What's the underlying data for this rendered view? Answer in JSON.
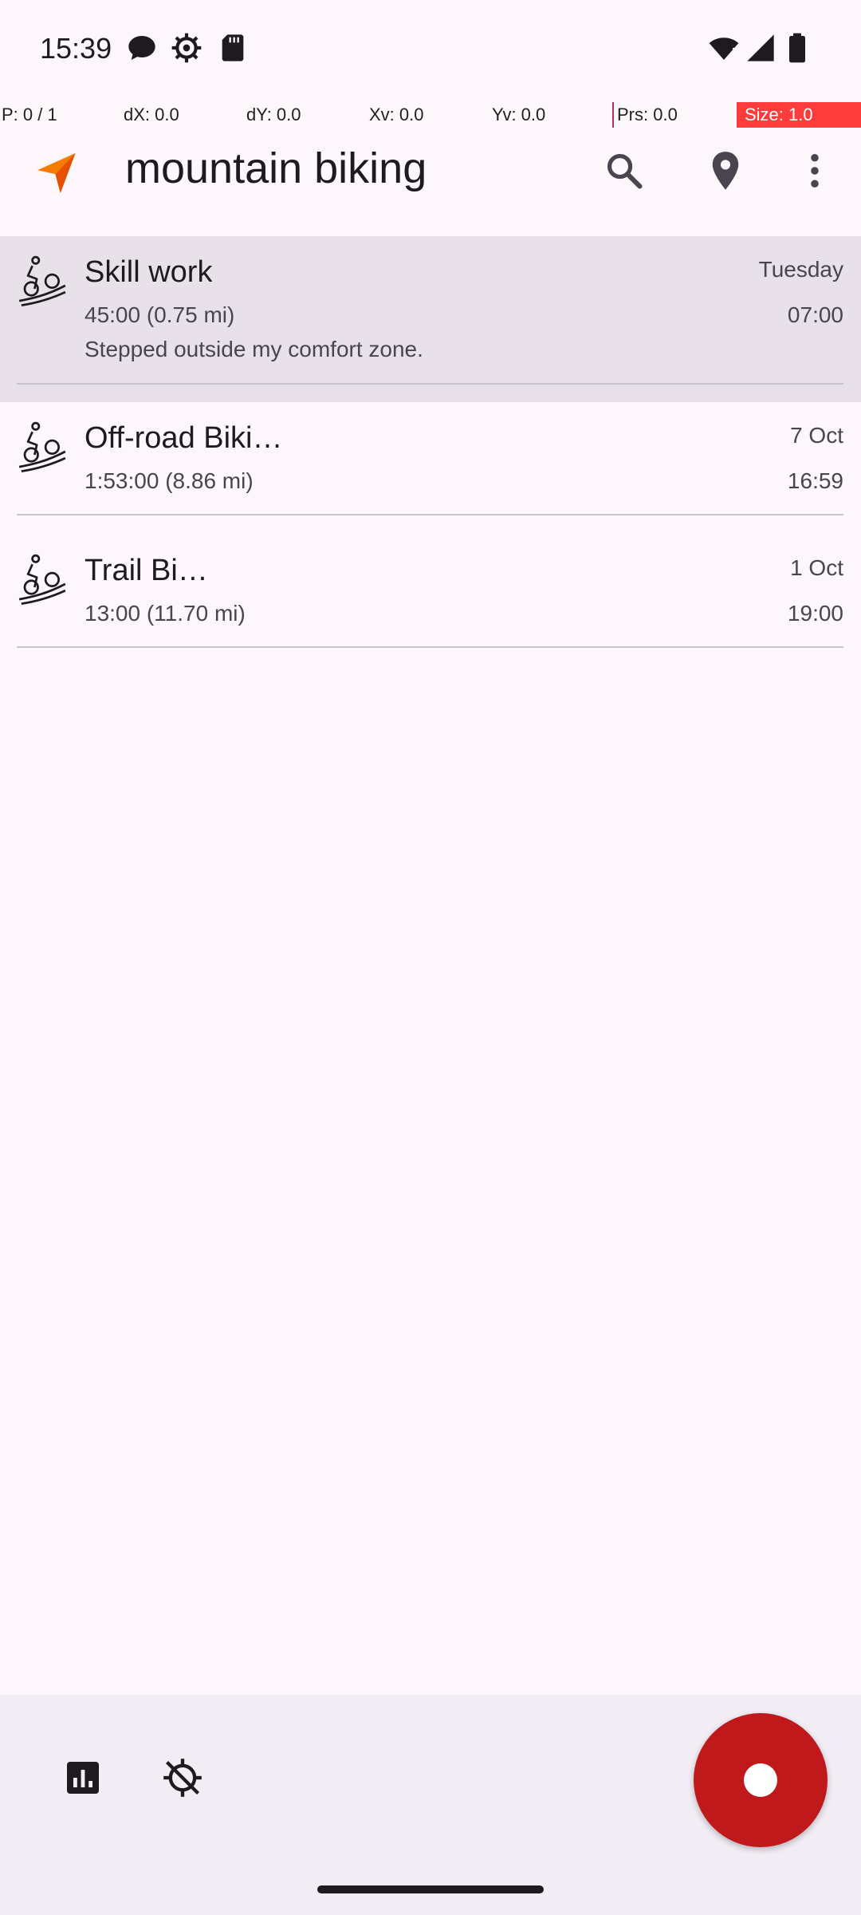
{
  "status_bar": {
    "time": "15:39",
    "left_icons": [
      "chat-bubble-icon",
      "gear-icon",
      "sd-card-icon"
    ],
    "right_icons": [
      "wifi-alert-icon",
      "signal-icon",
      "battery-icon"
    ]
  },
  "debug": {
    "pointer": "P: 0 / 1",
    "dx": "dX: 0.0",
    "dy": "dY: 0.0",
    "xv": "Xv: 0.0",
    "yv": "Yv: 0.0",
    "prs": "Prs: 0.0",
    "size": "Size: 1.0"
  },
  "app_bar": {
    "title": "mountain biking",
    "actions": [
      "search-icon",
      "map-marker-icon",
      "more-vert-icon"
    ]
  },
  "tracks": [
    {
      "title": "Skill work",
      "duration_distance": "45:00 (0.75 mi)",
      "date": "Tuesday",
      "time": "07:00",
      "note": "Stepped outside my comfort zone.",
      "selected": true
    },
    {
      "title": "Off-road Biki…",
      "duration_distance": "1:53:00 (8.86 mi)",
      "date": "7 Oct",
      "time": "16:59",
      "note": "",
      "selected": false
    },
    {
      "title": "Trail Bi…",
      "duration_distance": "13:00 (11.70 mi)",
      "date": "1 Oct",
      "time": "19:00",
      "note": "",
      "selected": false
    }
  ],
  "bottom_bar": {
    "actions": [
      "bar-chart-icon",
      "gps-off-icon"
    ],
    "fab": "record-icon"
  },
  "colors": {
    "background": "#fdf7fc",
    "selected_row": "#e8e1ea",
    "bottom_bar": "#f2ecf4",
    "fab": "#c0191c",
    "accent_logo": "#f57c00",
    "debug_size_bg": "#ff3b3b"
  }
}
